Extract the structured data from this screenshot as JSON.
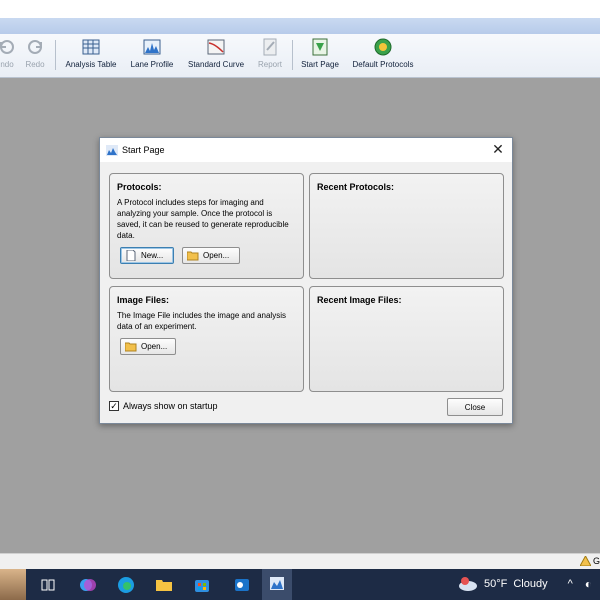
{
  "toolbar": {
    "items": [
      {
        "label": "ndo",
        "icon": "undo-icon",
        "disabled": true
      },
      {
        "label": "Redo",
        "icon": "redo-icon",
        "disabled": true
      },
      {
        "label": "Analysis Table",
        "icon": "table-icon",
        "disabled": false
      },
      {
        "label": "Lane Profile",
        "icon": "lane-profile-icon",
        "disabled": false
      },
      {
        "label": "Standard Curve",
        "icon": "standard-curve-icon",
        "disabled": false
      },
      {
        "label": "Report",
        "icon": "report-icon",
        "disabled": true
      },
      {
        "label": "Start Page",
        "icon": "start-page-icon",
        "disabled": false
      },
      {
        "label": "Default Protocols",
        "icon": "default-protocols-icon",
        "disabled": false
      }
    ]
  },
  "dialog": {
    "title": "Start Page",
    "close_glyph": "✕",
    "protocols": {
      "heading": "Protocols:",
      "description": "A Protocol includes steps for imaging and analyzing your sample. Once the protocol is saved, it can be reused to generate reproducible data.",
      "new_label": "New...",
      "open_label": "Open..."
    },
    "recent_protocols": {
      "heading": "Recent Protocols:"
    },
    "image_files": {
      "heading": "Image Files:",
      "description": "The Image File includes the image and analysis data of an experiment.",
      "open_label": "Open..."
    },
    "recent_image_files": {
      "heading": "Recent Image Files:"
    },
    "always_show_label": "Always show on startup",
    "always_show_checked": true,
    "checkmark": "✓",
    "close_label": "Close"
  },
  "status": {
    "warning_text": "G"
  },
  "taskbar": {
    "weather_temp": "50°F",
    "weather_condition": "Cloudy",
    "tray_chevron": "^"
  },
  "colors": {
    "accent": "#3c7fb1",
    "taskbar": "#1d2b45",
    "workspace": "#a0a0a0"
  }
}
